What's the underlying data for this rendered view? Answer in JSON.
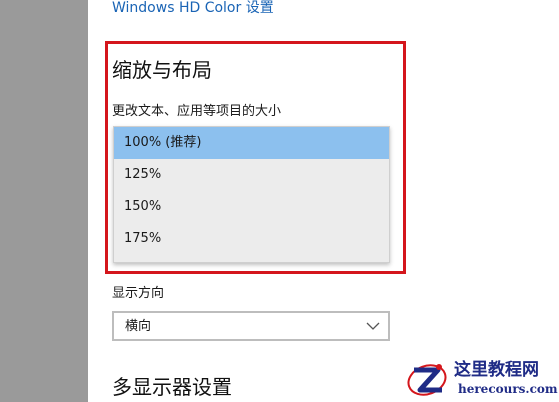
{
  "header": {
    "link_label": "Windows HD Color 设置"
  },
  "scale_layout": {
    "title": "缩放与布局",
    "change_size_label": "更改文本、应用等项目的大小",
    "options": [
      "100% (推荐)",
      "125%",
      "150%",
      "175%"
    ],
    "selected_index": 0
  },
  "orientation": {
    "label": "显示方向",
    "value": "横向"
  },
  "multi_display": {
    "title": "多显示器设置"
  },
  "watermark": {
    "cn": "这里教程网",
    "en": "herecours.com"
  },
  "colors": {
    "link": "#1a64b5",
    "highlight_border": "#d4161c",
    "selected_item": "#8cc0ee",
    "sidebar": "#9a9a9a"
  }
}
